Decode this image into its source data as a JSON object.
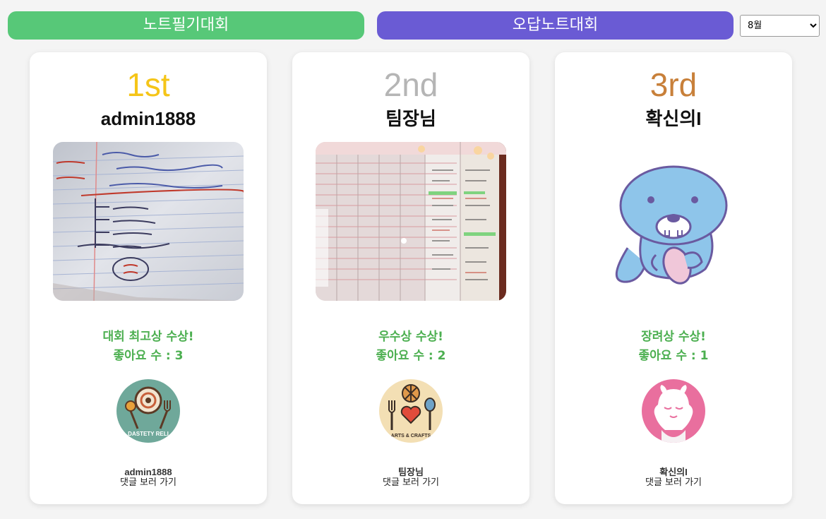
{
  "tabs": {
    "note_contest": {
      "label": "노트필기대회",
      "color": "#57c878"
    },
    "wrong_answer_contest": {
      "label": "오답노트대회",
      "color": "#6a5bd4"
    }
  },
  "month_select": {
    "selected": "8월"
  },
  "colors": {
    "award_text": "#4caf50",
    "card_bg": "#ffffff",
    "page_bg": "#f4f4f4"
  },
  "cards": [
    {
      "rank": "1st",
      "rank_color": "#f5c518",
      "name": "admin1888",
      "image": "handwritten-note-photo",
      "award": "대회 최고상 수상!",
      "likes": "좋아요 수 : 3",
      "avatar_icon": "food-utensils-logo-icon",
      "avatar_text": "DASTETY RELI",
      "footer_name": "admin1888",
      "comment_link": "댓글 보러 가기"
    },
    {
      "rank": "2nd",
      "rank_color": "#b5b5b5",
      "name": "팀장님",
      "image": "planner-page-photo",
      "award": "우수상 수상!",
      "likes": "좋아요 수 : 2",
      "avatar_icon": "arts-crafts-logo-icon",
      "avatar_text": "ARTS & CRAFTS",
      "footer_name": "팀장님",
      "comment_link": "댓글 보러 가기"
    },
    {
      "rank": "3rd",
      "rank_color": "#c8803a",
      "name": "확신의I",
      "image": "blue-seal-character",
      "award": "장려상 수상!",
      "likes": "좋아요 수 : 1",
      "avatar_icon": "pink-character-avatar-icon",
      "footer_name": "확신의I",
      "comment_link": "댓글 보러 가기"
    }
  ]
}
